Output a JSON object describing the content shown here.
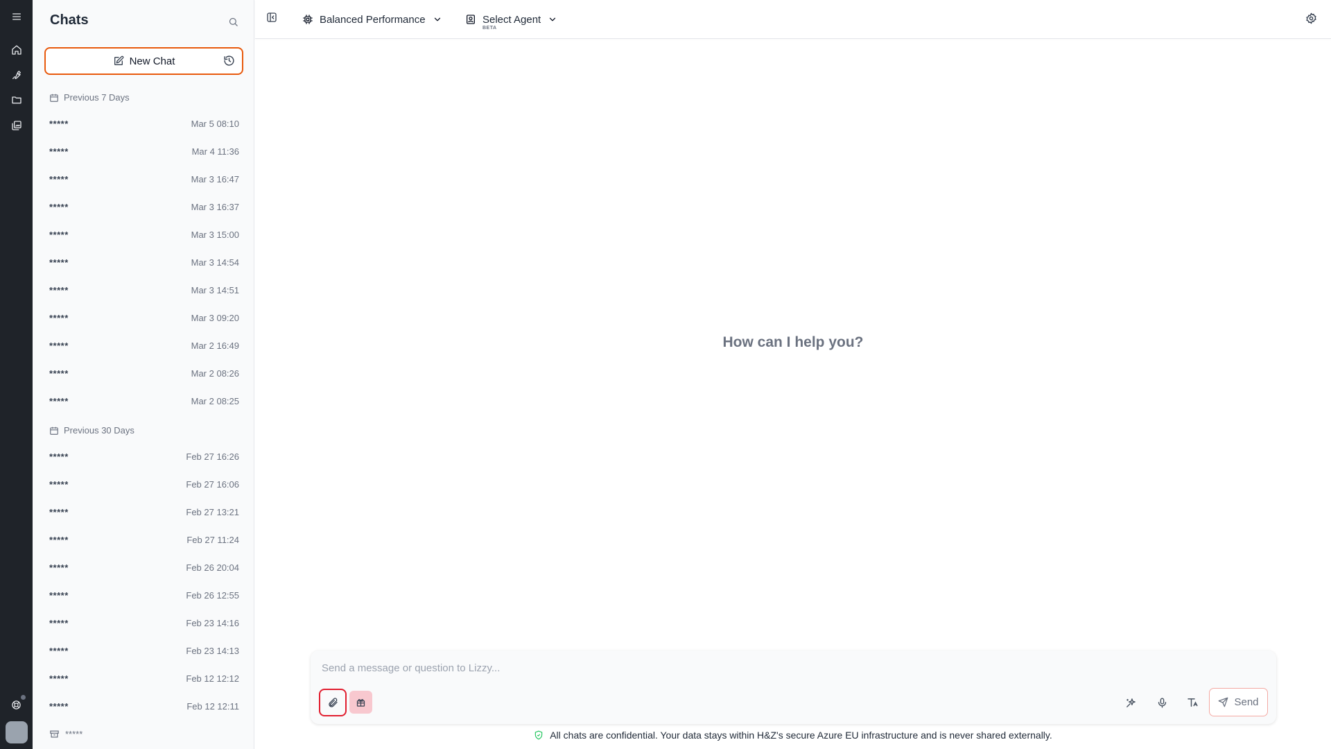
{
  "rail": {
    "items": [
      "menu-icon",
      "home-icon",
      "wrench-icon",
      "folder-icon",
      "gallery-icon"
    ],
    "bottom": [
      "help-icon",
      "avatar"
    ]
  },
  "sidebar": {
    "title": "Chats",
    "new_chat_label": "New Chat",
    "groups": [
      {
        "label": "Previous 7 Days",
        "items": [
          {
            "name": "*****",
            "time": "Mar 5 08:10"
          },
          {
            "name": "*****",
            "time": "Mar 4 11:36"
          },
          {
            "name": "*****",
            "time": "Mar 3 16:47"
          },
          {
            "name": "*****",
            "time": "Mar 3 16:37"
          },
          {
            "name": "*****",
            "time": "Mar 3 15:00"
          },
          {
            "name": "*****",
            "time": "Mar 3 14:54"
          },
          {
            "name": "*****",
            "time": "Mar 3 14:51"
          },
          {
            "name": "*****",
            "time": "Mar 3 09:20"
          },
          {
            "name": "*****",
            "time": "Mar 2 16:49"
          },
          {
            "name": "*****",
            "time": "Mar 2 08:26"
          },
          {
            "name": "*****",
            "time": "Mar 2 08:25"
          }
        ]
      },
      {
        "label": "Previous 30 Days",
        "items": [
          {
            "name": "*****",
            "time": "Feb 27 16:26"
          },
          {
            "name": "*****",
            "time": "Feb 27 16:06"
          },
          {
            "name": "*****",
            "time": "Feb 27 13:21"
          },
          {
            "name": "*****",
            "time": "Feb 27 11:24"
          },
          {
            "name": "*****",
            "time": "Feb 26 20:04"
          },
          {
            "name": "*****",
            "time": "Feb 26 12:55"
          },
          {
            "name": "*****",
            "time": "Feb 23 14:16"
          },
          {
            "name": "*****",
            "time": "Feb 23 14:13"
          },
          {
            "name": "*****",
            "time": "Feb 12 12:12"
          },
          {
            "name": "*****",
            "time": "Feb 12 12:11"
          }
        ]
      }
    ],
    "archived_label": "*****"
  },
  "topbar": {
    "model_label": "Balanced Performance",
    "agent_label": "Select Agent",
    "agent_badge": "BETA"
  },
  "main": {
    "headline": "How can I help you?",
    "input_placeholder": "Send a message or question to Lizzy...",
    "input_value": "",
    "send_label": "Send",
    "footer_text": "All chats are confidential. Your data stays within H&Z's secure Azure EU infrastructure and is never shared externally."
  },
  "colors": {
    "rail_bg": "#1f2329",
    "accent_orange": "#e8590c",
    "attach_highlight": "#e11d2e",
    "ruby_bg": "#f8c8cf",
    "shield_green": "#22c55e"
  }
}
